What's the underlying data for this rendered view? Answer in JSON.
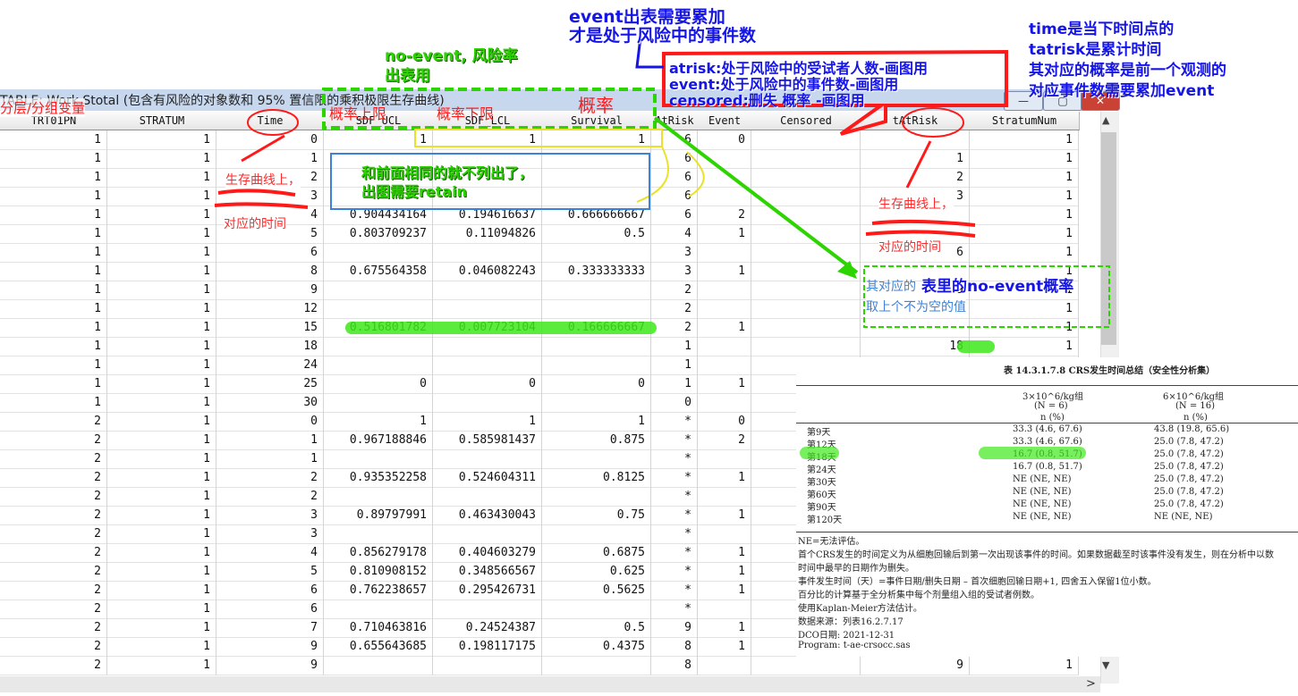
{
  "window": {
    "title": "TABLE: Work.Stotal (包含有风险的对象数和 95% 置信限的乘积极限生存曲线)",
    "minimize": "—",
    "maximize": "▢",
    "close": "✕"
  },
  "columns": [
    "TRT01PN",
    "STRATUM",
    "Time",
    "SDF_UCL",
    "SDF_LCL",
    "Survival",
    "AtRisk",
    "Event",
    "Censored",
    "tAtRisk",
    "StratumNum"
  ],
  "rows": [
    [
      "1",
      "1",
      "0",
      "1",
      "1",
      "1",
      "6",
      "0",
      "",
      "",
      "1"
    ],
    [
      "1",
      "1",
      "1",
      "",
      "",
      "",
      "6",
      "",
      "",
      "1",
      "1"
    ],
    [
      "1",
      "1",
      "2",
      "",
      "",
      "",
      "6",
      "",
      "",
      "2",
      "1"
    ],
    [
      "1",
      "1",
      "3",
      "",
      "",
      "",
      "6",
      "",
      "",
      "3",
      "1"
    ],
    [
      "1",
      "1",
      "4",
      "0.904434164",
      "0.194616637",
      "0.666666667",
      "6",
      "2",
      "",
      "",
      "1"
    ],
    [
      "1",
      "1",
      "5",
      "0.803709237",
      "0.11094826",
      "0.5",
      "4",
      "1",
      "",
      "",
      "1"
    ],
    [
      "1",
      "1",
      "6",
      "",
      "",
      "",
      "3",
      "",
      "",
      "6",
      "1"
    ],
    [
      "1",
      "1",
      "8",
      "0.675564358",
      "0.046082243",
      "0.333333333",
      "3",
      "1",
      "",
      "",
      "1"
    ],
    [
      "1",
      "1",
      "9",
      "",
      "",
      "",
      "2",
      "",
      "",
      "9",
      "1"
    ],
    [
      "1",
      "1",
      "12",
      "",
      "",
      "",
      "2",
      "",
      "",
      "12",
      "1"
    ],
    [
      "1",
      "1",
      "15",
      "0.516801782",
      "0.007723104",
      "0.166666667",
      "2",
      "1",
      "",
      "",
      "1"
    ],
    [
      "1",
      "1",
      "18",
      "",
      "",
      "",
      "1",
      "",
      "",
      "18",
      "1"
    ],
    [
      "1",
      "1",
      "24",
      "",
      "",
      "",
      "1",
      "",
      "",
      "",
      "1"
    ],
    [
      "1",
      "1",
      "25",
      "0",
      "0",
      "0",
      "1",
      "1",
      "",
      "",
      "1"
    ],
    [
      "1",
      "1",
      "30",
      "",
      "",
      "",
      "0",
      "",
      "",
      "",
      "1"
    ],
    [
      "2",
      "1",
      "0",
      "1",
      "1",
      "1",
      "*",
      "0",
      "",
      "",
      "1"
    ],
    [
      "2",
      "1",
      "1",
      "0.967188846",
      "0.585981437",
      "0.875",
      "*",
      "2",
      "",
      "",
      "1"
    ],
    [
      "2",
      "1",
      "1",
      "",
      "",
      "",
      "*",
      "",
      "",
      "",
      "1"
    ],
    [
      "2",
      "1",
      "2",
      "0.935352258",
      "0.524604311",
      "0.8125",
      "*",
      "1",
      "",
      "",
      "1"
    ],
    [
      "2",
      "1",
      "2",
      "",
      "",
      "",
      "*",
      "",
      "",
      "",
      "1"
    ],
    [
      "2",
      "1",
      "3",
      "0.89797991",
      "0.463430043",
      "0.75",
      "*",
      "1",
      "",
      "",
      "1"
    ],
    [
      "2",
      "1",
      "3",
      "",
      "",
      "",
      "*",
      "",
      "",
      "",
      "1"
    ],
    [
      "2",
      "1",
      "4",
      "0.856279178",
      "0.404603279",
      "0.6875",
      "*",
      "1",
      "",
      "",
      "1"
    ],
    [
      "2",
      "1",
      "5",
      "0.810908152",
      "0.348566567",
      "0.625",
      "*",
      "1",
      "",
      "",
      "1"
    ],
    [
      "2",
      "1",
      "6",
      "0.762238657",
      "0.295426731",
      "0.5625",
      "*",
      "1",
      "",
      "",
      "1"
    ],
    [
      "2",
      "1",
      "6",
      "",
      "",
      "",
      "*",
      "",
      "",
      "",
      "1"
    ],
    [
      "2",
      "1",
      "7",
      "0.710463816",
      "0.24524387",
      "0.5",
      "9",
      "1",
      "",
      "",
      "1"
    ],
    [
      "2",
      "1",
      "9",
      "0.655643685",
      "0.198117175",
      "0.4375",
      "8",
      "1",
      "",
      "",
      "1"
    ],
    [
      "2",
      "1",
      "9",
      "",
      "",
      "",
      "8",
      "",
      "",
      "9",
      "1"
    ]
  ],
  "annotations": {
    "event_note_1": "event出表需要累加",
    "event_note_2": "才是处于风险中的事件数",
    "noevent_1": "no-event, 风险率",
    "noevent_2": "出表用",
    "atrisk_def": "atrisk:处于风险中的受试者人数-画图用",
    "event_def": "event:处于风险中的事件数-画图用",
    "censored_def": "censored:删失 概率 -画图用",
    "time_1": "time是当下时间点的",
    "time_2": "tatrisk是累计时间",
    "time_3": "其对应的概率是前一个观测的",
    "time_4": "对应事件数需要累加event",
    "strat_label": "分层/分组变量",
    "prob_label": "概率",
    "ucl_label": "概率上限",
    "lcl_label": "概率下限",
    "curve_1": "生存曲线上，",
    "curve_2": "对应的时间",
    "tcurve_1": "生存曲线上，",
    "tcurve_2": "对应的时间",
    "same_1": "和前面相同的就不列出了，",
    "same_2": "出图需要retain",
    "noevent_table": "表里的no-event概率",
    "prev_1": "其对应的",
    "prev_2": "取上个不为空的值"
  },
  "report": {
    "title": "表 14.3.1.7.8 CRS发生时间总结（安全性分析集）",
    "col1_head": "3×10^6/kg组",
    "col1_n": "(N = 6)",
    "col2_head": "6×10^6/kg组",
    "col2_n": "(N = 16)",
    "unit": "n (%)",
    "rows": [
      {
        "label": "第9天",
        "a": "33.3 (4.6, 67.6)",
        "b": "43.8 (19.8, 65.6)"
      },
      {
        "label": "第12天",
        "a": "33.3 (4.6, 67.6)",
        "b": "25.0 (7.8, 47.2)"
      },
      {
        "label": "第18天",
        "a": "16.7 (0.8, 51.7)",
        "b": "25.0 (7.8, 47.2)"
      },
      {
        "label": "第24天",
        "a": "16.7 (0.8, 51.7)",
        "b": "25.0 (7.8, 47.2)"
      },
      {
        "label": "第30天",
        "a": "NE (NE, NE)",
        "b": "25.0 (7.8, 47.2)"
      },
      {
        "label": "第60天",
        "a": "NE (NE, NE)",
        "b": "25.0 (7.8, 47.2)"
      },
      {
        "label": "第90天",
        "a": "NE (NE, NE)",
        "b": "25.0 (7.8, 47.2)"
      },
      {
        "label": "第120天",
        "a": "NE (NE, NE)",
        "b": "NE (NE, NE)"
      }
    ],
    "notes": [
      "NE=无法评估。",
      "首个CRS发生的时间定义为从细胞回输后到第一次出现该事件的时间。如果数据截至时该事件没有发生，则在分析中以数",
      "时间中最早的日期作为删失。",
      "事件发生时间（天）=事件日期/删失日期 – 首次细胞回输日期+1, 四舍五入保留1位小数。",
      "百分比的计算基于全分析集中每个剂量组入组的受试者例数。",
      "使用Kaplan-Meier方法估计。",
      "数据来源：列表16.2.7.17",
      "DCO日期: 2021-12-31",
      "Program: t-ae-crsocc.sas"
    ]
  },
  "scrollbar": {
    "up": "▲",
    "down": "▼",
    "right": ">"
  },
  "colors": {
    "green_highlight": "#3ee81a",
    "annotation_red": "#ff1a1a",
    "annotation_blue": "#1515e8",
    "box_blue": "#3b82d8"
  }
}
